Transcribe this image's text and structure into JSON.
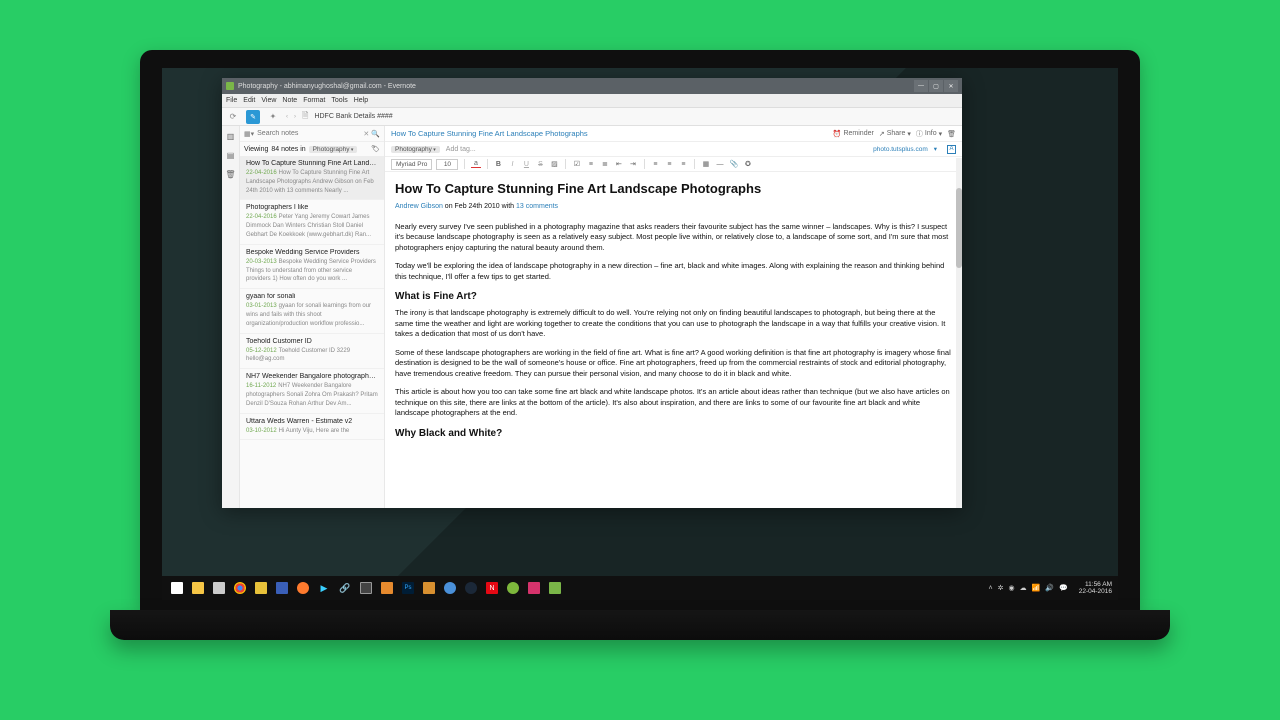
{
  "window": {
    "title": "Photography - abhimanyughoshal@gmail.com - Evernote",
    "breadcrumb": "HDFC Bank Details ####"
  },
  "menu": [
    "File",
    "Edit",
    "View",
    "Note",
    "Format",
    "Tools",
    "Help"
  ],
  "search": {
    "placeholder": "Search notes"
  },
  "list": {
    "count_prefix": "Viewing ",
    "count": "84 notes in",
    "notebook": "Photography"
  },
  "notes": [
    {
      "title": "How To Capture Stunning Fine Art Landsc...",
      "date": "22-04-2016",
      "snip": "How To Capture Stunning Fine Art Landscape Photographs Andrew Gibson on Feb 24th 2010 with 13 comments Nearly ..."
    },
    {
      "title": "Photographers I like",
      "date": "22-04-2016",
      "snip": "Peter Yang Jeremy Cowart James Dimmock Dan Winters Christian Stoll Daniel Gebhart De Koekkoek (www.gebhart.dk) Ran..."
    },
    {
      "title": "Bespoke Wedding Service Providers",
      "date": "20-03-2013",
      "snip": "Bespoke Wedding Service Providers Things to understand from other service providers 1) How often do you work ..."
    },
    {
      "title": "gyaan for sonali",
      "date": "03-01-2013",
      "snip": "gyaan for sonali learnings from our wins and fails with this shoot organization/production workflow professio..."
    },
    {
      "title": "Toehold Customer ID",
      "date": "05-12-2012",
      "snip": "Toehold Customer ID 3229 hello@ag.com"
    },
    {
      "title": "NH7 Weekender Bangalore photographers",
      "date": "16-11-2012",
      "snip": "NH7 Weekender Bangalore photographers Sonali Zohra Om Prakash? Pritam Denzil D'Souza Rohan Arthur Dev Am..."
    },
    {
      "title": "Uttara Weds Warren - Estimate v2",
      "date": "03-10-2012",
      "snip": "Hi Aunty Viju, Here are the"
    }
  ],
  "editor": {
    "title": "How To Capture Stunning Fine Art Landscape Photographs",
    "reminder": "Reminder",
    "share": "Share",
    "info": "Info",
    "tag": "Photography",
    "addtag": "Add tag...",
    "source": "photo.tutsplus.com",
    "font": "Myriad Pro",
    "size": "10"
  },
  "article": {
    "h1": "How To Capture Stunning Fine Art Landscape Photographs",
    "author": "Andrew Gibson",
    "byline_mid": " on Feb 24th 2010 with ",
    "comments": "13 comments",
    "p1": "Nearly every survey I've seen published in a photography magazine that asks readers their favourite subject has the same winner – landscapes. Why is this? I suspect it's because landscape photography is seen as a relatively easy subject. Most people live within, or relatively close to, a landscape of some sort, and I'm sure that most photographers enjoy capturing the natural beauty around them.",
    "p2": "Today we'll be exploring the idea of landscape photography in a new direction – fine art, black and white images. Along with explaining the reason and thinking behind this technique, I'll offer a few tips to get started.",
    "h2a": "What is Fine Art?",
    "p3": "The irony is that landscape photography is extremely difficult to do well. You're relying not only on finding beautiful landscapes to photograph, but being there at the same time the weather and light are working together to create the conditions that you can use to photograph the landscape in a way that fulfills your creative vision. It takes a dedication that most of us don't have.",
    "p4": "Some of these landscape photographers are working in the field of fine art. What is fine art? A good working definition is that fine art photography is imagery whose final destination is designed to be the wall of someone's house or office. Fine art photographers, freed up from the commercial restraints of stock and editorial photography, have tremendous creative freedom. They can pursue their personal vision, and many choose to do it in black and white.",
    "p5": "This article is about how you too can take some fine art black and white landscape photos. It's an article about ideas rather than technique (but we also have articles on technique on this site, there are links at the bottom of the article). It's also about inspiration, and there are links to some of our favourite fine art black and white landscape photographers at the end.",
    "h2b": "Why Black and White?"
  },
  "taskbar": {
    "time": "11:56 AM",
    "date": "22-04-2016"
  }
}
